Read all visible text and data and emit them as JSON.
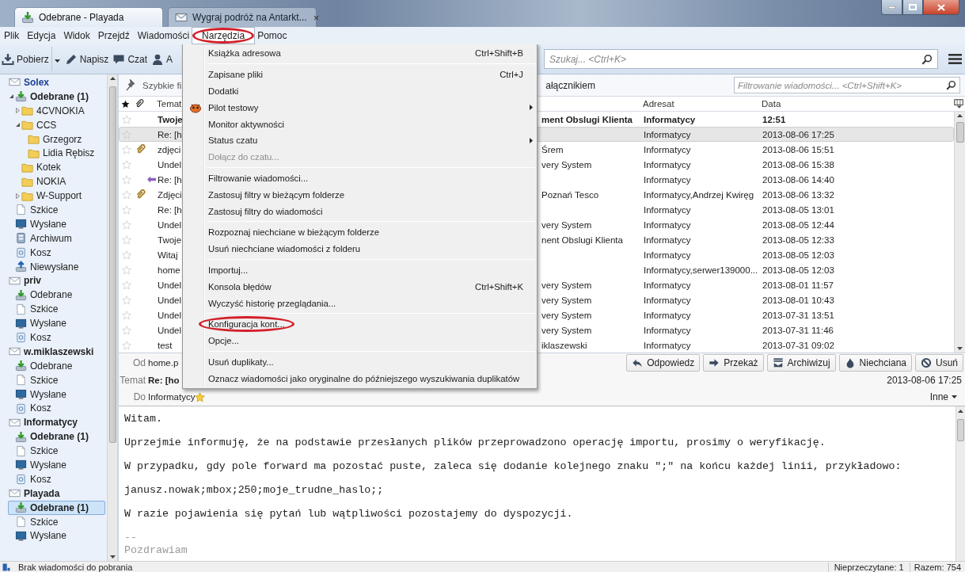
{
  "window": {
    "tabs": [
      {
        "label": "Odebrane - Playada",
        "selected": true,
        "kind": "folder"
      },
      {
        "label": "Wygraj podróż na Antarkt...",
        "selected": false,
        "kind": "message",
        "close": "×"
      }
    ]
  },
  "menubar": [
    {
      "label": "Plik",
      "open": false
    },
    {
      "label": "Edycja",
      "open": false
    },
    {
      "label": "Widok",
      "open": false
    },
    {
      "label": "Przejdź",
      "open": false
    },
    {
      "label": "Wiadomości",
      "open": false
    },
    {
      "label": "Narzędzia",
      "open": true,
      "circled": true
    },
    {
      "label": "Pomoc",
      "open": false
    }
  ],
  "toolbar": {
    "buttons": [
      {
        "label": "Pobierz",
        "kind": "get",
        "dropdown": true
      },
      {
        "label": "Napisz",
        "kind": "write"
      },
      {
        "label": "Czat",
        "kind": "chat"
      },
      {
        "label": "A",
        "kind": "contacts"
      }
    ],
    "search": {
      "placeholder": "Szukaj... <Ctrl+K>"
    }
  },
  "sidebar": {
    "accounts": [
      {
        "name": "Solex",
        "kind": "account",
        "new_mail": true,
        "selected": false,
        "children": [
          {
            "name": "Odebrane (1)",
            "kind": "inbox",
            "selected": false,
            "unread": true,
            "expanded": true,
            "children": [
              {
                "name": "4CVNOKIA",
                "kind": "folder",
                "selected": false,
                "unread": false,
                "expanded": false
              },
              {
                "name": "CCS",
                "kind": "folder",
                "selected": false,
                "unread": false,
                "expanded": true,
                "children": [
                  {
                    "name": "Grzegorz",
                    "kind": "folder",
                    "selected": false,
                    "unread": false
                  },
                  {
                    "name": "Lidia Rębisz",
                    "kind": "folder",
                    "selected": false,
                    "unread": false
                  }
                ]
              },
              {
                "name": "Kotek",
                "kind": "folder",
                "selected": false,
                "unread": false
              },
              {
                "name": "NOKIA",
                "kind": "folder",
                "selected": false,
                "unread": false
              },
              {
                "name": "W-Support",
                "kind": "folder",
                "selected": false,
                "unread": false,
                "expanded": false
              }
            ]
          },
          {
            "name": "Szkice",
            "kind": "drafts",
            "selected": false,
            "unread": false
          },
          {
            "name": "Wysłane",
            "kind": "sent",
            "selected": false,
            "unread": false
          },
          {
            "name": "Archiwum",
            "kind": "archive",
            "selected": false,
            "unread": false
          },
          {
            "name": "Kosz",
            "kind": "trash",
            "selected": false,
            "unread": false
          },
          {
            "name": "Niewysłane",
            "kind": "outbox",
            "selected": false,
            "unread": false
          }
        ]
      },
      {
        "name": "priv",
        "kind": "account",
        "new_mail": false,
        "selected": false,
        "children": [
          {
            "name": "Odebrane",
            "kind": "inbox",
            "selected": false,
            "unread": false
          },
          {
            "name": "Szkice",
            "kind": "drafts",
            "selected": false,
            "unread": false
          },
          {
            "name": "Wysłane",
            "kind": "sent",
            "selected": false,
            "unread": false
          },
          {
            "name": "Kosz",
            "kind": "trash",
            "selected": false,
            "unread": false
          }
        ]
      },
      {
        "name": "w.miklaszewski",
        "kind": "account",
        "new_mail": false,
        "selected": false,
        "children": [
          {
            "name": "Odebrane",
            "kind": "inbox",
            "selected": false,
            "unread": false
          },
          {
            "name": "Szkice",
            "kind": "drafts",
            "selected": false,
            "unread": false
          },
          {
            "name": "Wysłane",
            "kind": "sent",
            "selected": false,
            "unread": false
          },
          {
            "name": "Kosz",
            "kind": "trash",
            "selected": false,
            "unread": false
          }
        ]
      },
      {
        "name": "Informatycy",
        "kind": "account",
        "new_mail": false,
        "selected": false,
        "children": [
          {
            "name": "Odebrane (1)",
            "kind": "inbox",
            "selected": false,
            "unread": true
          },
          {
            "name": "Szkice",
            "kind": "drafts",
            "selected": false,
            "unread": false
          },
          {
            "name": "Wysłane",
            "kind": "sent",
            "selected": false,
            "unread": false
          },
          {
            "name": "Kosz",
            "kind": "trash",
            "selected": false,
            "unread": false
          }
        ]
      },
      {
        "name": "Playada",
        "kind": "account",
        "new_mail": false,
        "selected": false,
        "children": [
          {
            "name": "Odebrane (1)",
            "kind": "inbox",
            "selected": true,
            "unread": true
          },
          {
            "name": "Szkice",
            "kind": "drafts",
            "selected": false,
            "unread": false
          },
          {
            "name": "Wysłane",
            "kind": "sent",
            "selected": false,
            "unread": false
          }
        ]
      }
    ]
  },
  "quick_filter": {
    "label": "Szybkie fi",
    "attachment_label": "ałącznikiem",
    "filter": {
      "placeholder": "Filtrowanie wiadomości... <Ctrl+Shift+K>"
    }
  },
  "message_list": {
    "columns": [
      "Temat",
      "Adresat",
      "Data"
    ],
    "rows": [
      {
        "subject": "Twoje",
        "correspondent": "ment Obslugi Klienta",
        "recipient": "Informatycy",
        "date": "12:51",
        "unread": true,
        "selected": false,
        "starred": false
      },
      {
        "subject": "Re: [h",
        "recipient": "Informatycy",
        "date": "2013-08-06 17:25",
        "unread": false,
        "selected": true,
        "starred": false
      },
      {
        "subject": "zdjęci",
        "correspondent": "Śrem",
        "recipient": "Informatycy",
        "date": "2013-08-06 15:51",
        "unread": false,
        "selected": false,
        "starred": false,
        "attachment": true
      },
      {
        "subject": "Undel",
        "correspondent": "very System",
        "recipient": "Informatycy",
        "date": "2013-08-06 15:38",
        "unread": false,
        "selected": false,
        "starred": false
      },
      {
        "subject": "Re: [h",
        "recipient": "Informatycy",
        "date": "2013-08-06 14:40",
        "unread": false,
        "selected": false,
        "starred": false,
        "replied": true
      },
      {
        "subject": "Zdjęci",
        "correspondent": "Poznań Tesco",
        "recipient": "Informatycy,Andrzej Kwiręg",
        "date": "2013-08-06 13:32",
        "unread": false,
        "selected": false,
        "starred": false,
        "attachment": true
      },
      {
        "subject": "Re: [h",
        "recipient": "Informatycy",
        "date": "2013-08-05 13:01",
        "unread": false,
        "selected": false,
        "starred": false
      },
      {
        "subject": "Undel",
        "correspondent": "very System",
        "recipient": "Informatycy",
        "date": "2013-08-05 12:44",
        "unread": false,
        "selected": false,
        "starred": false
      },
      {
        "subject": "Twoje",
        "correspondent": "nent Obslugi Klienta",
        "recipient": "Informatycy",
        "date": "2013-08-05 12:33",
        "unread": false,
        "selected": false,
        "starred": false
      },
      {
        "subject": "Witaj",
        "recipient": "Informatycy",
        "date": "2013-08-05 12:03",
        "unread": false,
        "selected": false,
        "starred": false
      },
      {
        "subject": "home",
        "recipient": "Informatycy,serwer139000...",
        "date": "2013-08-05 12:03",
        "unread": false,
        "selected": false,
        "starred": false
      },
      {
        "subject": "Undel",
        "correspondent": "very System",
        "recipient": "Informatycy",
        "date": "2013-08-01 11:57",
        "unread": false,
        "selected": false,
        "starred": false
      },
      {
        "subject": "Undel",
        "correspondent": "very System",
        "recipient": "Informatycy",
        "date": "2013-08-01 10:43",
        "unread": false,
        "selected": false,
        "starred": false
      },
      {
        "subject": "Undel",
        "correspondent": "very System",
        "recipient": "Informatycy",
        "date": "2013-07-31 13:51",
        "unread": false,
        "selected": false,
        "starred": false
      },
      {
        "subject": "Undel",
        "correspondent": "very System",
        "recipient": "Informatycy",
        "date": "2013-07-31 11:46",
        "unread": false,
        "selected": false,
        "starred": false
      },
      {
        "subject": "test",
        "correspondent": "iklaszewski",
        "recipient": "Informatycy",
        "date": "2013-07-31 09:02",
        "unread": false,
        "selected": false,
        "starred": false
      }
    ]
  },
  "message": {
    "from_label": "Od",
    "from": "home.p",
    "subject_label": "Temat",
    "subject": "Re: [ho",
    "to_label": "Do",
    "to": "Informatycy",
    "date": "2013-08-06 17:25",
    "more": "Inne",
    "buttons": [
      {
        "label": "Odpowiedz",
        "kind": "reply"
      },
      {
        "label": "Przekaż",
        "kind": "forward"
      },
      {
        "label": "Archiwizuj",
        "kind": "archive"
      },
      {
        "label": "Niechciana",
        "kind": "junk"
      },
      {
        "label": "Usuń",
        "kind": "delete"
      }
    ],
    "body": [
      "Witam.",
      "Uprzejmie informuję, że na podstawie przesłanych plików przeprowadzono operację importu, prosimy o weryfikację.",
      "W przypadku, gdy pole forward ma pozostać puste, zaleca się dodanie kolejnego znaku \";\" na końcu każdej linii, przykładowo:",
      "janusz.nowak;mbox;250;moje_trudne_haslo;;",
      "W razie pojawienia się pytań lub wątpliwości pozostajemy do dyspozycji."
    ],
    "signature": [
      "--",
      "Pozdrawiam"
    ]
  },
  "status_bar": {
    "text": "Brak wiadomości do pobrania",
    "unread": "Nieprzeczytane: 1",
    "total": "Razem: 754"
  },
  "menu": {
    "items": [
      {
        "kind": "item",
        "label": "Książka adresowa",
        "shortcut": "Ctrl+Shift+B",
        "disabled": false
      },
      {
        "kind": "separator"
      },
      {
        "kind": "item",
        "label": "Zapisane pliki",
        "shortcut": "Ctrl+J",
        "disabled": false
      },
      {
        "kind": "item",
        "label": "Dodatki",
        "disabled": false
      },
      {
        "kind": "plugin",
        "label": "Pilot testowy",
        "submenu": true,
        "disabled": false
      },
      {
        "kind": "item",
        "label": "Monitor aktywności",
        "disabled": false
      },
      {
        "kind": "item",
        "label": "Status czatu",
        "submenu": true,
        "disabled": false
      },
      {
        "kind": "item",
        "label": "Dołącz do czatu...",
        "disabled": true
      },
      {
        "kind": "separator"
      },
      {
        "kind": "item",
        "label": "Filtrowanie wiadomości...",
        "disabled": false
      },
      {
        "kind": "item",
        "label": "Zastosuj filtry w bieżącym folderze",
        "disabled": false
      },
      {
        "kind": "item",
        "label": "Zastosuj filtry do wiadomości",
        "disabled": false
      },
      {
        "kind": "separator"
      },
      {
        "kind": "item",
        "label": "Rozpoznaj niechciane w bieżącym folderze",
        "disabled": false
      },
      {
        "kind": "item",
        "label": "Usuń niechciane wiadomości z folderu",
        "disabled": false
      },
      {
        "kind": "separator"
      },
      {
        "kind": "item",
        "label": "Importuj...",
        "disabled": false
      },
      {
        "kind": "item",
        "label": "Konsola błędów",
        "shortcut": "Ctrl+Shift+K",
        "disabled": false
      },
      {
        "kind": "item",
        "label": "Wyczyść historię przeglądania...",
        "disabled": false
      },
      {
        "kind": "separator"
      },
      {
        "kind": "item",
        "label": "Konfiguracja kont...",
        "disabled": false,
        "circled": true
      },
      {
        "kind": "item",
        "label": "Opcje...",
        "disabled": false
      },
      {
        "kind": "separator"
      },
      {
        "kind": "item",
        "label": "Usuń duplikaty...",
        "disabled": false
      },
      {
        "kind": "item",
        "label": "Oznacz wiadomości jako oryginalne do późniejszego wyszukiwania duplikatów",
        "disabled": false
      }
    ]
  }
}
